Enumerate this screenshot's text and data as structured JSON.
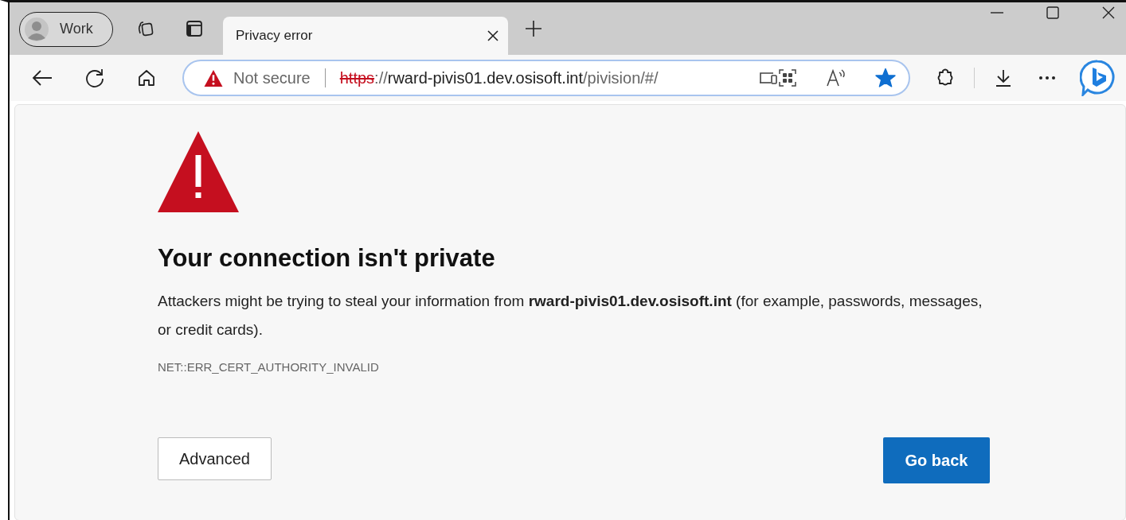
{
  "profile": {
    "label": "Work"
  },
  "tab": {
    "title": "Privacy error",
    "selected": true
  },
  "address_bar": {
    "security": "Not secure",
    "url_parts": [
      {
        "kind": "struck",
        "text": "https"
      },
      {
        "kind": "muted",
        "text": "://"
      },
      {
        "kind": "host",
        "text": "rward-pivis01.dev.osisoft.int"
      },
      {
        "kind": "muted",
        "text": "/pivision/#/"
      }
    ],
    "favorite": true
  },
  "page": {
    "heading": "Your connection isn't private",
    "description": "Attackers might be trying to steal your information from **rward-pivis01.dev.osisoft.int** (for example, passwords, messages, or credit cards).",
    "error_code": "NET::ERR_CERT_AUTHORITY_INVALID",
    "buttons": [
      {
        "label": "Advanced",
        "kind": "secondary"
      },
      {
        "label": "Go back",
        "kind": "primary"
      }
    ]
  }
}
